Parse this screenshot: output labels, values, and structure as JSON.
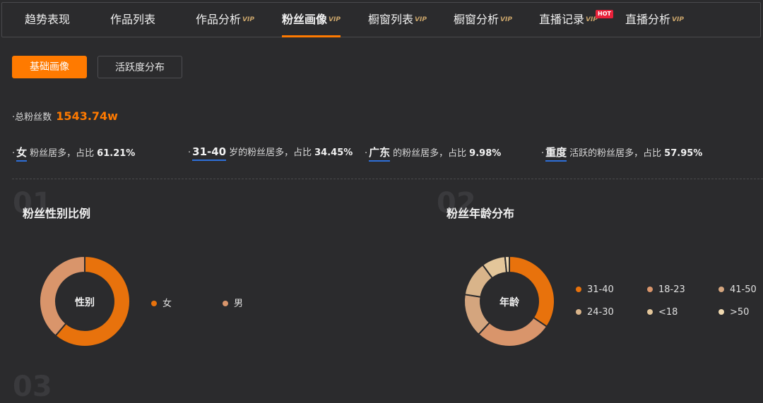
{
  "nav": {
    "tabs": [
      {
        "label": "趋势表现",
        "vip": false
      },
      {
        "label": "作品列表",
        "vip": false
      },
      {
        "label": "作品分析",
        "vip": true
      },
      {
        "label": "粉丝画像",
        "vip": true,
        "active": true
      },
      {
        "label": "橱窗列表",
        "vip": true
      },
      {
        "label": "橱窗分析",
        "vip": true
      },
      {
        "label": "直播记录",
        "vip": true,
        "badge": "HOT"
      },
      {
        "label": "直播分析",
        "vip": true
      }
    ],
    "vip_text": "VIP"
  },
  "subtabs": {
    "basic": "基础画像",
    "activity": "活跃度分布"
  },
  "summary": {
    "total_label": "总粉丝数",
    "total_value": "1543.74w"
  },
  "stats": [
    {
      "key": "女",
      "text": "粉丝居多，占比",
      "pct": "61.21%"
    },
    {
      "key": "31-40",
      "text": "岁的粉丝居多，占比",
      "pct": "34.45%"
    },
    {
      "key": "广东",
      "text": "的粉丝居多，占比",
      "pct": "9.98%"
    },
    {
      "key": "重度",
      "text": "活跃的粉丝居多，占比",
      "pct": "57.95%"
    }
  ],
  "sections": {
    "s1": {
      "num": "01",
      "title": "粉丝性别比例",
      "center": "性别"
    },
    "s2": {
      "num": "02",
      "title": "粉丝年龄分布",
      "center": "年龄"
    },
    "s3": {
      "num": "03"
    }
  },
  "chart_data": [
    {
      "type": "pie",
      "categories": [
        "女",
        "男"
      ],
      "values": [
        61.21,
        38.79
      ],
      "colors": [
        "#e8720c",
        "#d9956b"
      ]
    },
    {
      "type": "pie",
      "categories": [
        "31-40",
        "18-23",
        "41-50",
        "24-30",
        "<18",
        ">50"
      ],
      "values": [
        34.45,
        27.5,
        15.5,
        12.5,
        8.5,
        1.55
      ],
      "colors": [
        "#e8720c",
        "#d9956b",
        "#d4a57e",
        "#d9b48a",
        "#e3c69a",
        "#efd9b0"
      ]
    }
  ]
}
